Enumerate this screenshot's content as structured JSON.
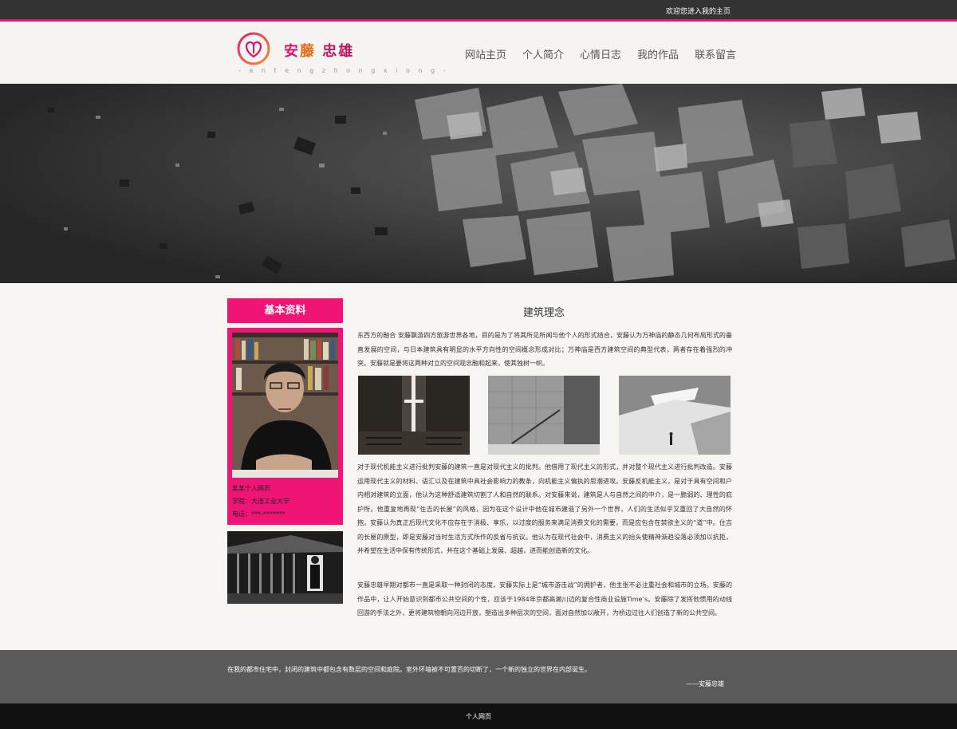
{
  "topbar": {
    "welcome": "欢迎您进入我的主页"
  },
  "logo": {
    "name_part1": "安",
    "name_part2": "藤",
    "name_part3": " 忠雄",
    "pinyin": "- a n t e n g z h o n g x i o n g -"
  },
  "nav": {
    "items": [
      {
        "label": "网站主页"
      },
      {
        "label": "个人简介"
      },
      {
        "label": "心情日志"
      },
      {
        "label": "我的作品"
      },
      {
        "label": "联系留言"
      }
    ]
  },
  "sidebar": {
    "title": "基本资料",
    "info": {
      "line1": "某某个人网页",
      "line2": "学院：大连工业大学",
      "line3": "电话：***-*******"
    }
  },
  "article": {
    "title": "建筑理念",
    "paragraph1": "东西方的融合 安藤飘游四方旅游世界各地，目的是为了将其所见所闻与他个人的形式结合，安藤认为万神庙的静态几何布局形式的垂直发展的空间，与日本建筑具有明显的水平方向性的空间概念形成对比；万神庙是西方建筑空间的典型代表，两者存在着强烈的冲突。安藤就是要将这两种对立的空间观念融和起来，使其独树一帜。",
    "paragraph2": "对于现代机能主义进行批判安藤的建筑一直是对现代主义的批判。他借用了现代主义的形式，并对整个现代主义进行批判改造。安藤运用现代主义的材料、语汇以及在建筑中具社会影响力的教条，向机能主义偏执的思潮进攻。安藤反机能主义，是对于具有空间和户内相对建筑的立面，他认为这种舒适建筑切割了人和自然的联系。对安藤来说，建筑是人与自然之间的中介，是一脆弱的、理性的庇护所。他重复地再现“住吉的长屋”的风格，因为在这个设计中他在城市建造了另外一个世界，人们的生活似乎又重回了大自然的怀抱。安藤认为真正后现代文化不应存在于消极、享乐，以过度的服务来满足消费文化的需要，而是应包含在禁欲主义的“道”中。住吉的长屋的原型，即是安藤对当时生活方式所作的反省与抗议。他认为在现代社会中，消费主义的抬头使精神渐趋没落必须加以抗拒，并希望在生活中保有传统形式，并在这个基础上发展、超越，进而能创造新的文化。",
    "paragraph3": "安藤忠雄早期对都市一直是采取一种封闭的态度，安藤实际上是“城市游击战”的拥护者，他主张不必注重社会和城市的立场。安藤的作品中，让人开始意识到都市公共空间的个性，应该于1984年京都高濑川边的复合性商业设施Time’s。安藤除了发挥他惯用的动线回游的手法之外，更将建筑物朝向河边开放，塑造出多种层次的空间，面对自然加以敞开，为桥边过往人们创造了新的公共空间。"
  },
  "footer": {
    "quote": "在我的都市住宅中，封闭的建筑中都包含有数层的空间和庭院。室外环墙被不可置否的切断了，一个新的独立的世界在内部诞生。",
    "author": "——安藤忠雄",
    "bottom_label": "个人网页"
  },
  "colors": {
    "accent": "#ef1476",
    "topbar": "#333333",
    "footer": "#5a5a5a",
    "bottombar": "#111111"
  }
}
